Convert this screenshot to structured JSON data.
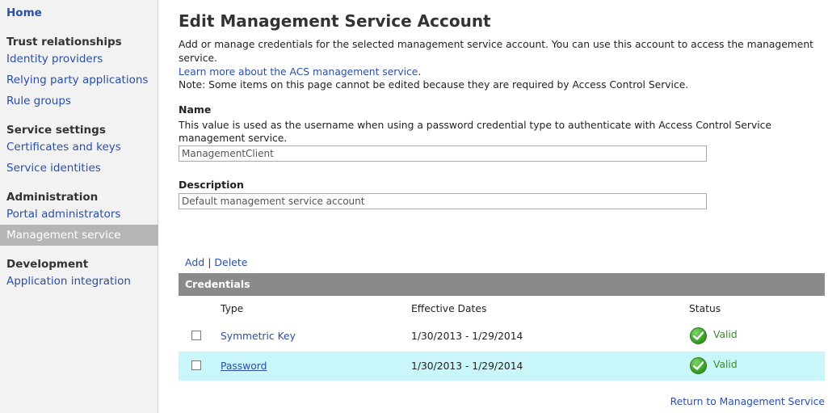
{
  "sidebar": {
    "home": "Home",
    "sections": [
      {
        "heading": "Trust relationships",
        "items": [
          "Identity providers",
          "Relying party applications",
          "Rule groups"
        ]
      },
      {
        "heading": "Service settings",
        "items": [
          "Certificates and keys",
          "Service identities"
        ]
      },
      {
        "heading": "Administration",
        "items": [
          "Portal administrators",
          "Management service"
        ]
      },
      {
        "heading": "Development",
        "items": [
          "Application integration"
        ]
      }
    ],
    "selected": "Management service"
  },
  "page": {
    "title": "Edit Management Service Account",
    "description": "Add or manage credentials for the selected management service account. You can use this account to access the management service.",
    "learn_more": "Learn more about the ACS management service",
    "learn_more_suffix": ".",
    "note": "Note: Some items on this page cannot be edited because they are required by Access Control Service."
  },
  "name_field": {
    "label": "Name",
    "help": "This value is used as the username when using a password credential type to authenticate with Access Control Service management service.",
    "value": "ManagementClient"
  },
  "description_field": {
    "label": "Description",
    "value": "Default management service account"
  },
  "actions": {
    "add": "Add",
    "separator": "|",
    "delete": "Delete"
  },
  "credentials": {
    "title": "Credentials",
    "columns": {
      "type": "Type",
      "dates": "Effective Dates",
      "status": "Status"
    },
    "rows": [
      {
        "type": "Symmetric Key",
        "dates": "1/30/2013 - 1/29/2014",
        "status": "Valid",
        "highlighted": false
      },
      {
        "type": "Password",
        "dates": "1/30/2013 - 1/29/2014",
        "status": "Valid",
        "highlighted": true
      }
    ]
  },
  "footer": {
    "return_link": "Return to Management Service"
  },
  "colors": {
    "link": "#2b4ea8",
    "selected_nav": "#b5b5b5",
    "grid_header": "#8a8a8a",
    "row_highlight": "#c9f6f8",
    "valid": "#3a8a2a"
  },
  "icons": {
    "status": "check-circle-icon"
  }
}
